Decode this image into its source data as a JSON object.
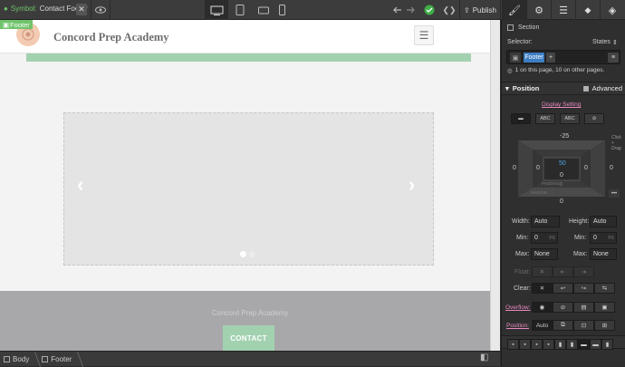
{
  "toolbar": {
    "symbol_prefix": "Symbol:",
    "symbol_name": "Contact Footer",
    "close": "✕",
    "publish": "Publish"
  },
  "canvas": {
    "badge": "Footer",
    "brand": "Concord Prep Academy",
    "hamburger": "☰",
    "prev_arrow": "‹",
    "next_arrow": "›",
    "footer_text": "Concord Prep Academy",
    "contact_button": "CONTACT"
  },
  "breadcrumb": {
    "items": [
      "Body",
      "Footer"
    ]
  },
  "panel": {
    "section_label": "Section",
    "selector_label": "Selector:",
    "states_label": "States",
    "selector_pill": "Footer",
    "add_symbol": "+",
    "usage_text": "1 on this page, 10 on other pages.",
    "position_heading": "Position",
    "advanced_label": "Advanced",
    "display_setting": "Display Setting",
    "display_options": [
      "ABC",
      "ABC"
    ],
    "box": {
      "margin_top": "-25",
      "margin_left": "0",
      "margin_right": "0",
      "margin_bottom": "0",
      "padding_top": "50",
      "padding_left": "0",
      "padding_right": "0",
      "padding_bottom": "0",
      "inner": "0",
      "padding_label": "PADDING",
      "margin_label": "MARGIN",
      "hint_line1": "Click",
      "hint_line2": "+ Drag"
    },
    "width_label": "Width:",
    "width_value": "Auto",
    "height_label": "Height:",
    "height_value": "Auto",
    "min_label": "Min:",
    "min_w_value": "0",
    "min_h_value": "0",
    "px_unit": "PX",
    "max_label": "Max:",
    "max_w_value": "None",
    "max_h_value": "None",
    "float_label": "Float:",
    "float_none": "✕",
    "clear_label": "Clear:",
    "clear_none": "✕",
    "overflow_label": "Overflow:",
    "position_label": "Position:",
    "position_value": "Auto"
  },
  "accent_green": "#6fc36a",
  "selector_blue": "#3d7ec3"
}
